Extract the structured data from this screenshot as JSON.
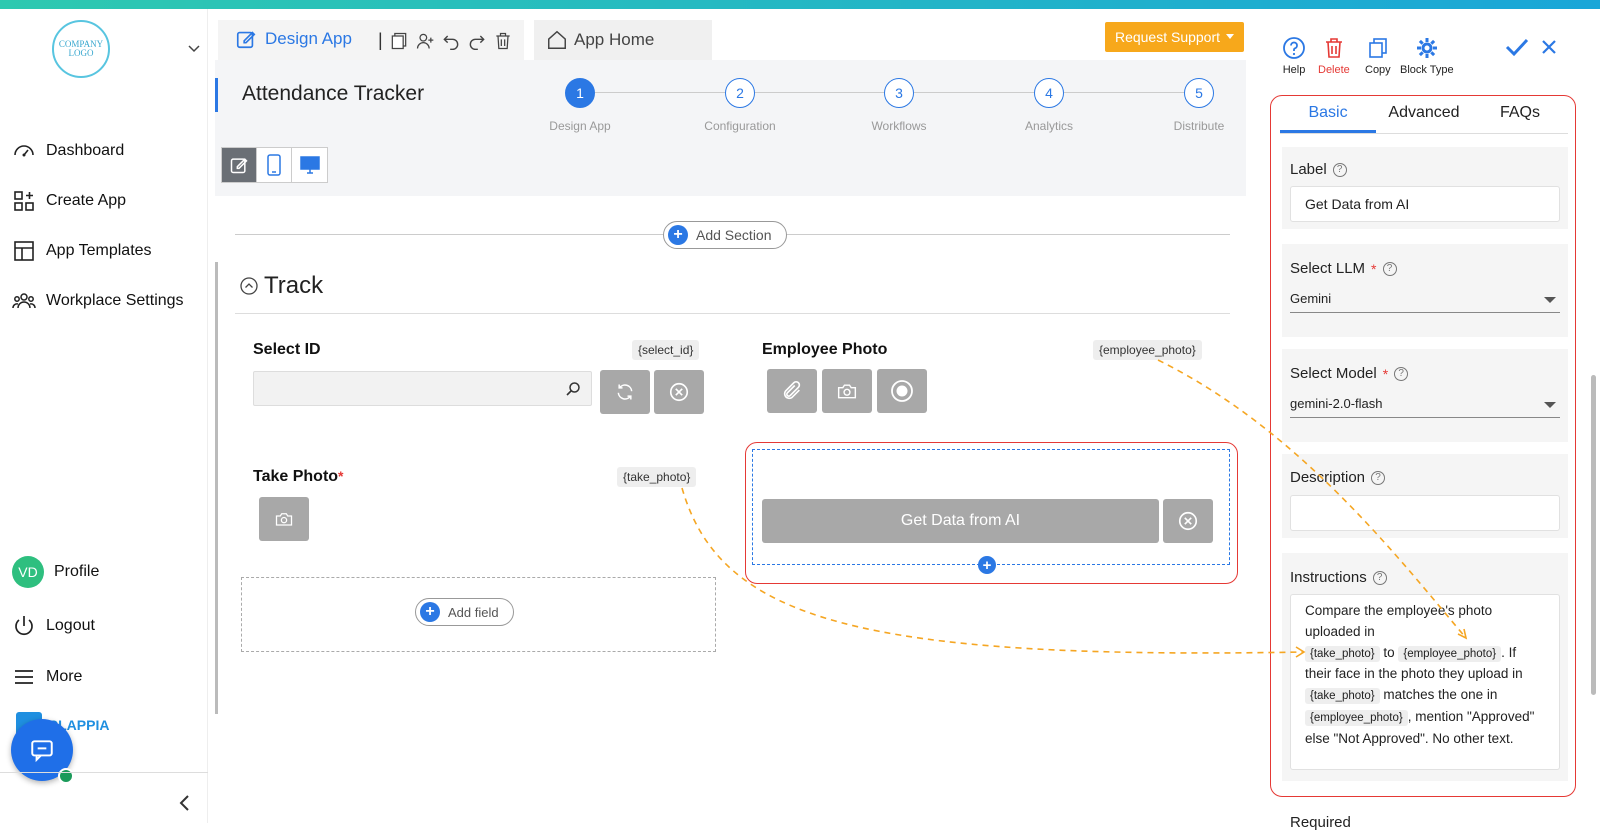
{
  "sidebar": {
    "logo_text": "COMPANY LOGO",
    "nav": [
      {
        "label": "Dashboard",
        "icon": "gauge-icon"
      },
      {
        "label": "Create App",
        "icon": "grid-plus-icon"
      },
      {
        "label": "App Templates",
        "icon": "template-icon"
      },
      {
        "label": "Workplace Settings",
        "icon": "users-icon"
      }
    ],
    "profile": {
      "initials": "VD",
      "label": "Profile"
    },
    "logout_label": "Logout",
    "more_label": "More",
    "brand": "CLAPPIA"
  },
  "header": {
    "design_app": "Design App",
    "app_home": "App Home",
    "request_support": "Request Support"
  },
  "app": {
    "title": "Attendance Tracker",
    "steps": [
      {
        "n": "1",
        "label": "Design App"
      },
      {
        "n": "2",
        "label": "Configuration"
      },
      {
        "n": "3",
        "label": "Workflows"
      },
      {
        "n": "4",
        "label": "Analytics"
      },
      {
        "n": "5",
        "label": "Distribute"
      }
    ]
  },
  "form": {
    "add_section": "Add Section",
    "section_title": "Track",
    "fields": {
      "select_id": {
        "label": "Select ID",
        "var": "{select_id}"
      },
      "employee_photo": {
        "label": "Employee Photo",
        "var": "{employee_photo}"
      },
      "take_photo": {
        "label": "Take Photo",
        "var": "{take_photo}",
        "required": "*"
      },
      "ai": {
        "label": "Get Data from AI"
      }
    },
    "add_field": "Add field"
  },
  "panel": {
    "actions": {
      "help": "Help",
      "delete": "Delete",
      "copy": "Copy",
      "block_type": "Block Type"
    },
    "tabs": [
      "Basic",
      "Advanced",
      "FAQs"
    ],
    "label_title": "Label",
    "label_value": "Get Data from AI",
    "llm_title": "Select LLM",
    "llm_value": "Gemini",
    "model_title": "Select Model",
    "model_value": "gemini-2.0-flash",
    "description_title": "Description",
    "instructions_title": "Instructions",
    "instructions": {
      "p1": "Compare the employee's photo uploaded in",
      "chip1": "{take_photo}",
      "p2": " to ",
      "chip2": "{employee_photo}",
      "p3": ". If their face in the photo they upload in",
      "chip3": "{take_photo}",
      "p4": " matches the one in",
      "chip4": "{employee_photo}",
      "p5": ", mention \"Approved\" else \"Not Approved\". No other text."
    },
    "required_title": "Required",
    "required_star": "*"
  },
  "colors": {
    "accent": "#2b78e4",
    "support": "#f7a81b",
    "highlight": "#e53935",
    "arrow": "#f5a623"
  }
}
